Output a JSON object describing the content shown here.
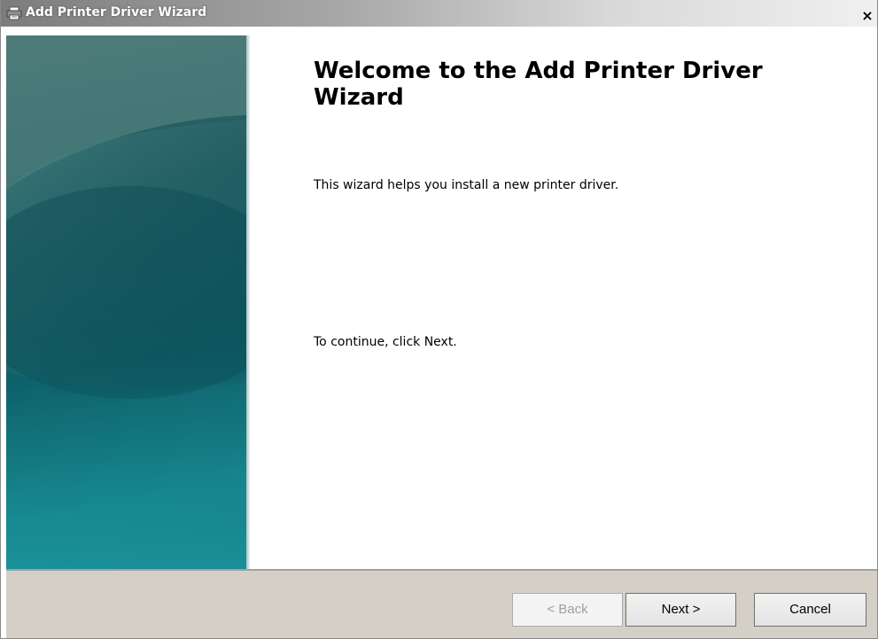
{
  "window": {
    "title": "Add Printer Driver Wizard",
    "close_label": "×",
    "icon": "printer-icon"
  },
  "content": {
    "heading": "Welcome to the Add Printer Driver Wizard",
    "description": "This wizard helps you install a new printer driver.",
    "continue_text": "To continue, click Next."
  },
  "buttons": {
    "back": "< Back",
    "next": "Next >",
    "cancel": "Cancel"
  },
  "state": {
    "back_enabled": false
  },
  "colors": {
    "banner_teal": "#0e5f68",
    "footer_bg": "#d4d0c8"
  }
}
